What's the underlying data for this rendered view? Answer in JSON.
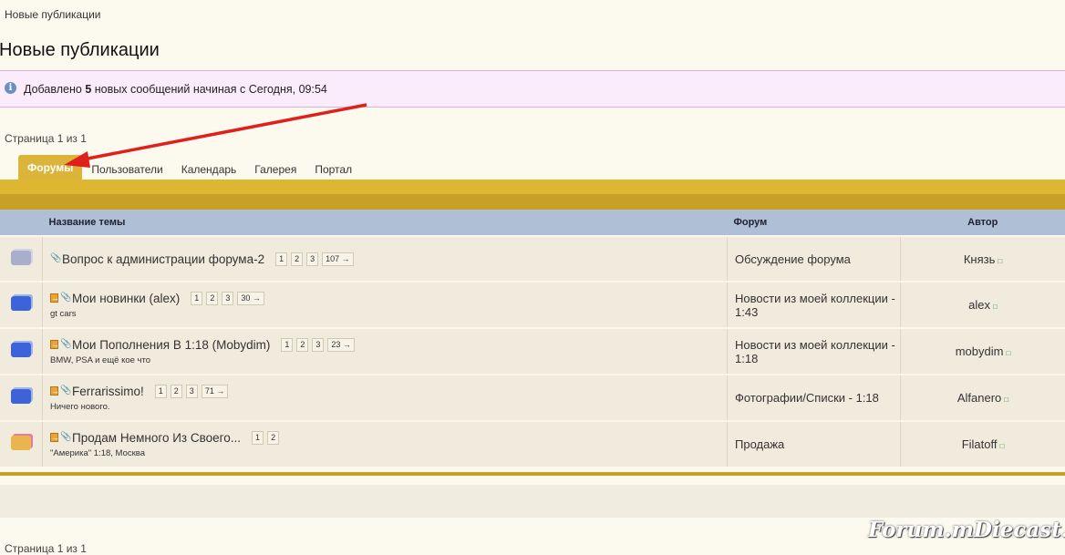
{
  "breadcrumb": "Новые публикации",
  "page_title": "Новые публикации",
  "notice": {
    "prefix": "Добавлено ",
    "count": "5",
    "suffix": " новых сообщений начиная с Сегодня, 09:54"
  },
  "page_counter_top": "Страница 1 из 1",
  "page_counter_bottom": "Страница 1 из 1",
  "tabs": [
    {
      "label": "Форумы",
      "active": true
    },
    {
      "label": "Пользователи"
    },
    {
      "label": "Календарь"
    },
    {
      "label": "Галерея"
    },
    {
      "label": "Портал"
    }
  ],
  "table": {
    "headers": {
      "title": "Название темы",
      "forum": "Форум",
      "author": "Автор"
    },
    "rows": [
      {
        "title": "Вопрос к администрации форума-2",
        "pages": [
          "1",
          "2",
          "3",
          "107 →"
        ],
        "desc": "",
        "forum": "Обсуждение форума",
        "author": "Князь",
        "icon": "grey",
        "new": false
      },
      {
        "title": "Мои новинки (alex)",
        "pages": [
          "1",
          "2",
          "3",
          "30 →"
        ],
        "desc": "gt cars",
        "forum": "Новости из моей коллекции - 1:43",
        "author": "alex",
        "icon": "blue",
        "new": true
      },
      {
        "title": "Мои Пополнения В 1:18 (Mobydim)",
        "pages": [
          "1",
          "2",
          "3",
          "23 →"
        ],
        "desc": "BMW, PSA и ещё кое что",
        "forum": "Новости из моей коллекции - 1:18",
        "author": "mobydim",
        "icon": "blue",
        "new": true
      },
      {
        "title": "Ferrarissimo!",
        "pages": [
          "1",
          "2",
          "3",
          "71 →"
        ],
        "desc": "Ничего нового.",
        "forum": "Фотографии/Списки - 1:18",
        "author": "Alfanero",
        "icon": "blue",
        "new": true
      },
      {
        "title": "Продам Немного Из Своего...",
        "pages": [
          "1",
          "2"
        ],
        "desc": "\"Америка\" 1:18, Москва",
        "forum": "Продажа",
        "author": "Filatoff",
        "icon": "orange",
        "new": true
      }
    ]
  },
  "watermark": "Forum.mDiecast.com",
  "colors": {
    "accent_gold": "#ddb632",
    "header_blue": "#aebfd6",
    "notice_bg": "#fbecfb",
    "arrow_red": "#e0201b"
  }
}
